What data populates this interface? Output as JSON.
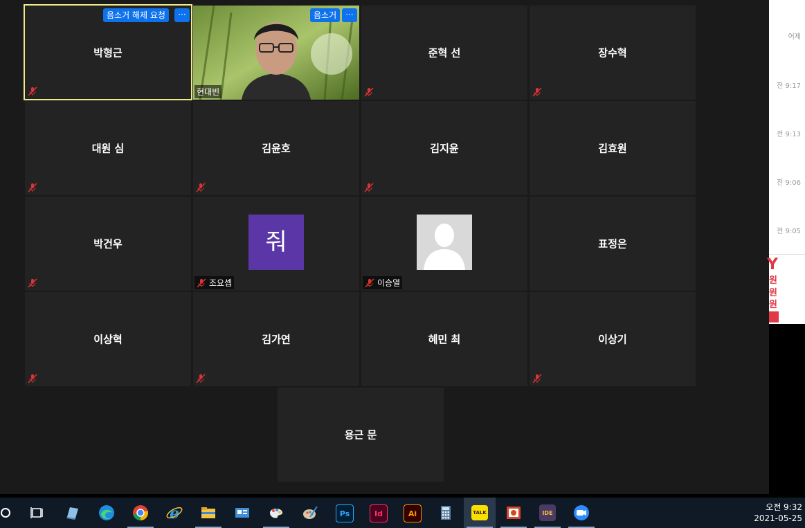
{
  "participants": [
    {
      "name": "박형근",
      "muted": true
    },
    {
      "name": "현대빈",
      "muted": false
    },
    {
      "name": "준혁 선",
      "muted": true
    },
    {
      "name": "장수혁",
      "muted": true
    },
    {
      "name": "대원 심",
      "muted": true
    },
    {
      "name": "김윤호",
      "muted": true
    },
    {
      "name": "김지윤",
      "muted": true
    },
    {
      "name": "김효원",
      "muted": false
    },
    {
      "name": "박건우",
      "muted": true
    },
    {
      "name": "조요셉",
      "muted": true,
      "avatar_letter": "줘"
    },
    {
      "name": "이승열",
      "muted": true
    },
    {
      "name": "표정은",
      "muted": false
    },
    {
      "name": "이상혁",
      "muted": true
    },
    {
      "name": "김가연",
      "muted": true
    },
    {
      "name": "혜민 최",
      "muted": false
    },
    {
      "name": "이상기",
      "muted": true
    },
    {
      "name": "용근 문",
      "muted": false
    }
  ],
  "controls": {
    "unmute_request_label": "음소거 해제 요청",
    "mute_label": "음소거",
    "more_label": "···"
  },
  "background_window": {
    "times": [
      "어제",
      "전 9:17",
      "전 9:13",
      "전 9:06",
      "전 9:05"
    ],
    "ad_letter": "Y",
    "ad_lines": [
      "원",
      "원",
      "원"
    ]
  },
  "taskbar": {
    "apps": [
      {
        "name": "start",
        "icon": "cortana-circle-icon"
      },
      {
        "name": "task-view",
        "icon": "task-view-icon"
      },
      {
        "name": "notepad",
        "icon": "notepad-icon"
      },
      {
        "name": "edge",
        "icon": "edge-icon"
      },
      {
        "name": "chrome",
        "icon": "chrome-icon"
      },
      {
        "name": "ie",
        "icon": "ie-icon"
      },
      {
        "name": "explorer",
        "icon": "folder-icon"
      },
      {
        "name": "contacts",
        "icon": "contact-card-icon"
      },
      {
        "name": "paint-3d",
        "icon": "paint-3d-icon"
      },
      {
        "name": "paint",
        "icon": "palette-icon"
      },
      {
        "name": "photoshop",
        "icon": "photoshop-icon",
        "text": "Ps"
      },
      {
        "name": "indesign",
        "icon": "indesign-icon",
        "text": "Id"
      },
      {
        "name": "illustrator",
        "icon": "illustrator-icon",
        "text": "Ai"
      },
      {
        "name": "calculator",
        "icon": "calculator-icon"
      },
      {
        "name": "kakaotalk",
        "icon": "kakaotalk-icon",
        "text": "TALK"
      },
      {
        "name": "powerpoint",
        "icon": "powerpoint-icon"
      },
      {
        "name": "ide",
        "icon": "ide-gear-icon",
        "text": "IDE"
      },
      {
        "name": "zoom",
        "icon": "zoom-camera-icon"
      }
    ],
    "clock_time": "오전 9:32",
    "clock_date": "2021-05-25"
  }
}
